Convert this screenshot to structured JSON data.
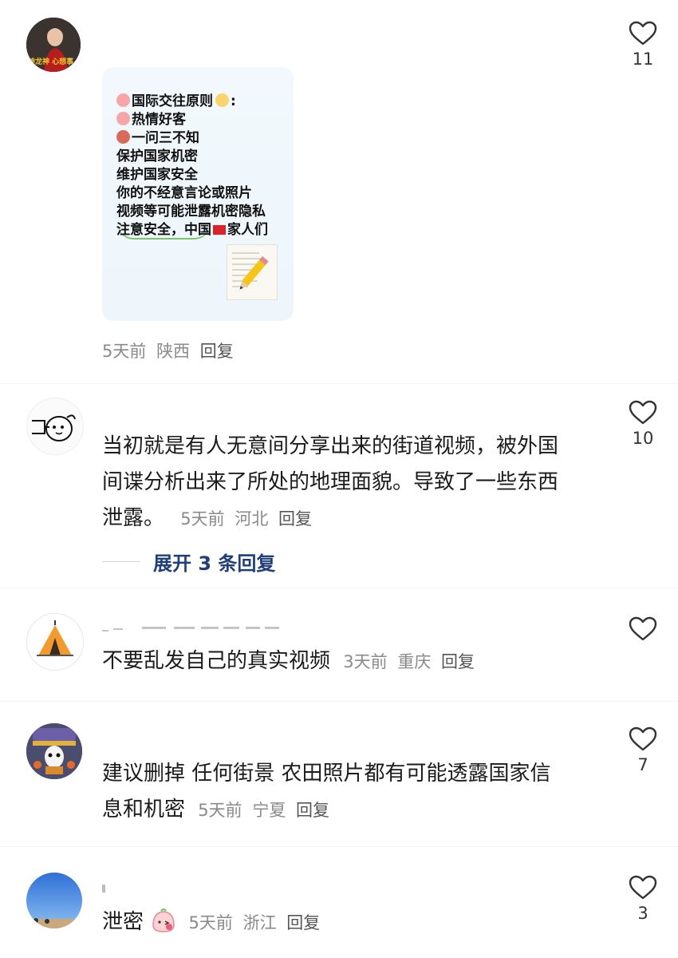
{
  "comments": [
    {
      "id": "c1",
      "avatar_caption": "神龙神 心想事",
      "image_card": {
        "lines": [
          "国际交往原则",
          "热情好客",
          "一问三不知",
          "保护国家机密",
          "维护国家安全",
          "你的不经意言论或照片",
          "视频等可能泄露机密隐私",
          "注意安全，中国",
          "家人们"
        ],
        "colon": ":"
      },
      "meta": {
        "time": "5天前",
        "location": "陕西",
        "reply": "回复"
      },
      "likes": "11"
    },
    {
      "id": "c2",
      "text_line1": "当初就是有人无意间分享出来的街道视频，被外国",
      "text_line2": "间谍分析出来了所处的地理面貌。导致了一些东西",
      "text_line3": "泄露。",
      "meta": {
        "time": "5天前",
        "location": "河北",
        "reply": "回复"
      },
      "expand_label": "展开 3 条回复",
      "likes": "10"
    },
    {
      "id": "c3",
      "text": "不要乱发自己的真实视频",
      "meta": {
        "time": "3天前",
        "location": "重庆",
        "reply": "回复"
      },
      "likes": ""
    },
    {
      "id": "c4",
      "text_line1": "建议删掉 任何街景 农田照片都有可能透露国家信",
      "text_line2": "息和机密",
      "meta": {
        "time": "5天前",
        "location": "宁夏",
        "reply": "回复"
      },
      "likes": "7"
    },
    {
      "id": "c5",
      "text": "泄密",
      "meta": {
        "time": "5天前",
        "location": "浙江",
        "reply": "回复"
      },
      "likes": "3"
    }
  ],
  "colors": {
    "expand_link": "#1f3e7a",
    "meta_gray": "#8a8a8a"
  }
}
